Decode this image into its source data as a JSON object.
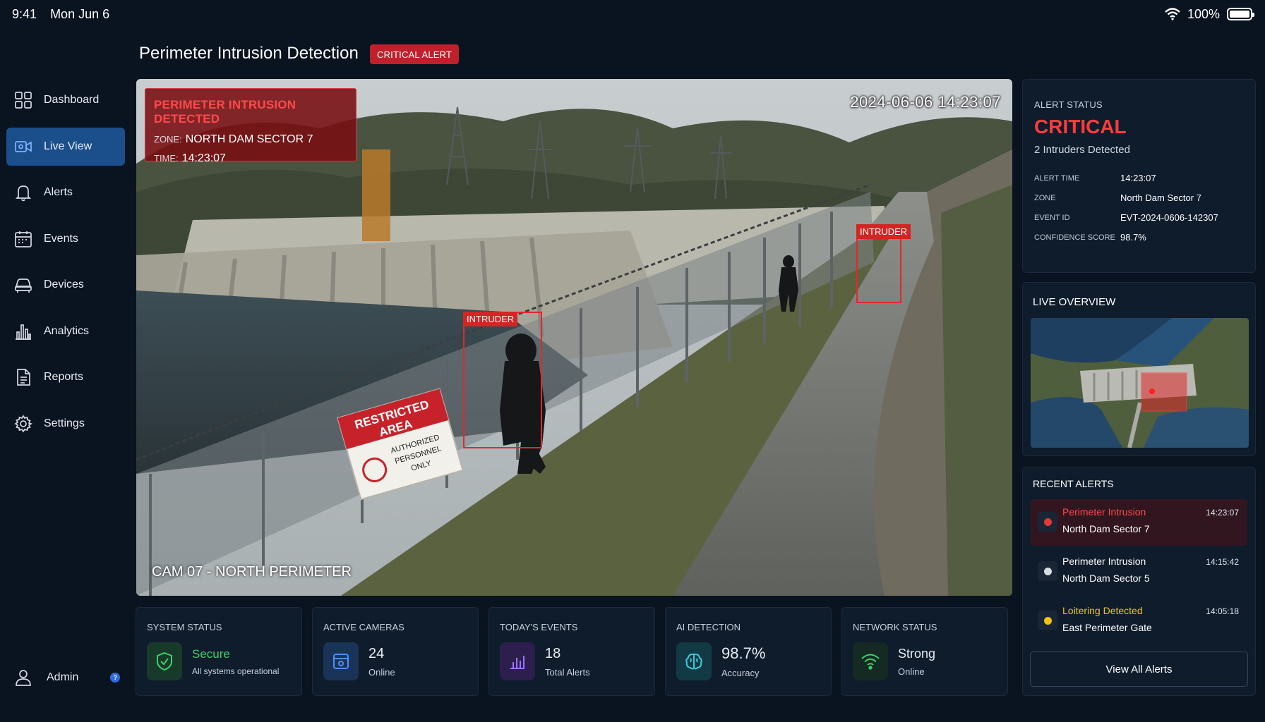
{
  "status_bar": {
    "time": "9:41",
    "date": "Mon Jun 6",
    "battery": "100%"
  },
  "sidebar": {
    "items": [
      {
        "label": "Dashboard",
        "icon": "grid-icon"
      },
      {
        "label": "Live View",
        "icon": "camera-icon",
        "active": true
      },
      {
        "label": "Alerts",
        "icon": "bell-icon"
      },
      {
        "label": "Events",
        "icon": "calendar-icon"
      },
      {
        "label": "Devices",
        "icon": "vehicle-icon"
      },
      {
        "label": "Analytics",
        "icon": "bar-chart-icon"
      },
      {
        "label": "Reports",
        "icon": "document-icon"
      },
      {
        "label": "Settings",
        "icon": "gear-icon"
      }
    ],
    "user": {
      "name": "Admin",
      "badge": "?"
    }
  },
  "header": {
    "title": "Perimeter Intrusion Detection",
    "badge": "CRITICAL ALERT"
  },
  "video": {
    "overlay": {
      "heading": "PERIMETER INTRUSION DETECTED",
      "zone_label": "ZONE:",
      "zone": "NORTH DAM SECTOR 7",
      "time_label": "TIME:",
      "time": "14:23:07"
    },
    "timestamp": "2024-06-06 14:23:07",
    "camera": "CAM 07 - NORTH PERIMETER",
    "detections": [
      {
        "label": "INTRUDER"
      },
      {
        "label": "INTRUDER"
      }
    ],
    "sign": {
      "line1": "RESTRICTED",
      "line2": "AREA",
      "line3": "AUTHORIZED",
      "line4": "PERSONNEL",
      "line5": "ONLY"
    }
  },
  "alert_status": {
    "caption": "ALERT STATUS",
    "level": "CRITICAL",
    "summary": "2 Intruders Detected",
    "details": [
      {
        "key": "ALERT TIME",
        "value": "14:23:07"
      },
      {
        "key": "ZONE",
        "value": "North Dam Sector 7"
      },
      {
        "key": "EVENT ID",
        "value": "EVT-2024-0606-142307"
      },
      {
        "key": "CONFIDENCE SCORE",
        "value": "98.7%"
      }
    ]
  },
  "live_overview": {
    "title": "LIVE OVERVIEW"
  },
  "recent_alerts": {
    "title": "RECENT ALERTS",
    "items": [
      {
        "title": "Perimeter Intrusion",
        "location": "North Dam Sector 7",
        "time": "14:23:07",
        "color": "#ff4a4a",
        "dot": "#e53935"
      },
      {
        "title": "Perimeter Intrusion",
        "location": "North Dam Sector 5",
        "time": "14:15:42",
        "color": "#ffffff",
        "dot": "#d9dde3"
      },
      {
        "title": "Loitering Detected",
        "location": "East Perimeter Gate",
        "time": "14:05:18",
        "color": "#f4c20d",
        "dot": "#f4c20d"
      }
    ],
    "view_all": "View All Alerts"
  },
  "stats": [
    {
      "caption": "SYSTEM STATUS",
      "value": "Secure",
      "sub": "All systems operational",
      "icon": "shield-check-icon",
      "color": "#3ecf6a"
    },
    {
      "caption": "ACTIVE CAMERAS",
      "value": "24",
      "sub": "Online",
      "icon": "camera-icon",
      "color": "#4a90ff"
    },
    {
      "caption": "TODAY'S EVENTS",
      "value": "18",
      "sub": "Total Alerts",
      "icon": "bar-chart-icon",
      "color": "#a070ff"
    },
    {
      "caption": "AI DETECTION",
      "value": "98.7%",
      "sub": "Accuracy",
      "icon": "brain-icon",
      "color": "#3fc7d8"
    },
    {
      "caption": "NETWORK STATUS",
      "value": "Strong",
      "sub": "Online",
      "icon": "wifi-icon",
      "color": "#3ecf6a"
    }
  ]
}
